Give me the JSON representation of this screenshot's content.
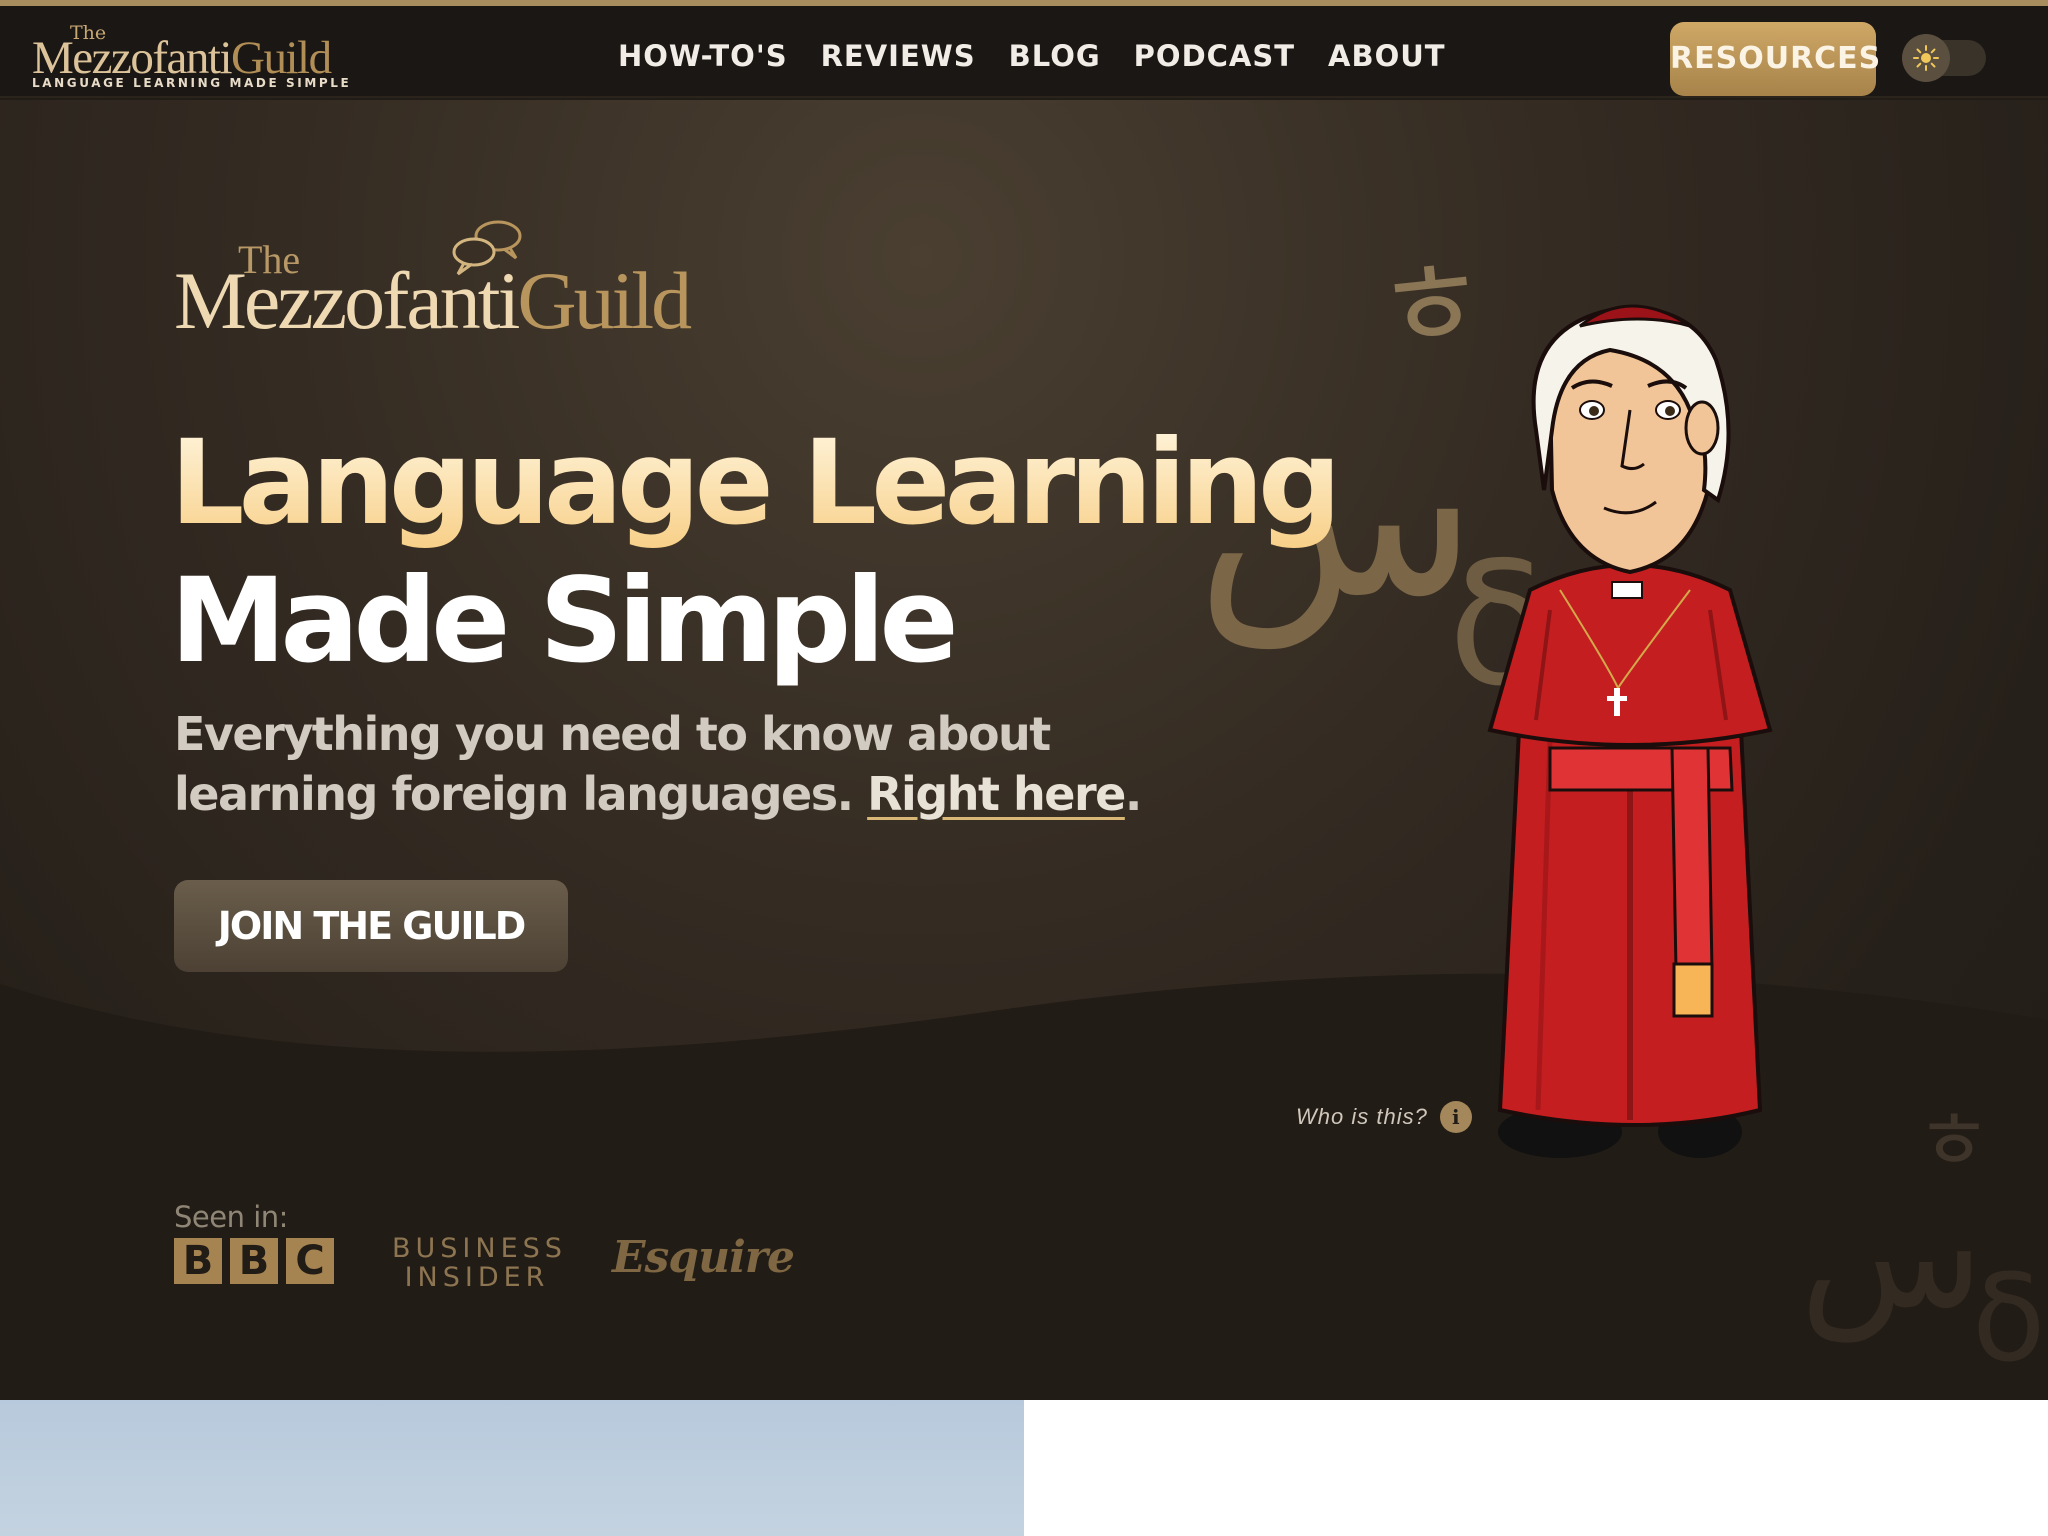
{
  "nav": {
    "logo_the": "The",
    "logo_name_a": "Mezzofanti",
    "logo_name_b": "Guild",
    "logo_tagline": "LANGUAGE LEARNING MADE SIMPLE",
    "menu": [
      {
        "label": "HOW-TO'S"
      },
      {
        "label": "REVIEWS"
      },
      {
        "label": "BLOG"
      },
      {
        "label": "PODCAST"
      },
      {
        "label": "ABOUT"
      }
    ],
    "resources_label": "RESOURCES",
    "theme_toggle_icon": "sun-icon"
  },
  "hero": {
    "logo_the": "The",
    "logo_name_a": "Mezzofanti",
    "logo_name_b": "Guild",
    "headline_line1": "Language Learning",
    "headline_line2": "Made Simple",
    "subtitle_text": "Everything you need to know about learning foreign languages.",
    "subtitle_link": "Right here",
    "subtitle_end": ".",
    "cta_label": "JOIN THE GUILD",
    "who_label": "Who is this?",
    "info_icon": "i",
    "seen_in_label": "Seen in:",
    "press": {
      "bbc_letters": [
        "B",
        "B",
        "C"
      ],
      "business_insider_line1": "BUSINESS",
      "business_insider_line2": "INSIDER",
      "esquire": "Esquire"
    },
    "glyph_korean": "ㅎ",
    "glyph_arabic": "س",
    "glyph_greek": "δ"
  },
  "colors": {
    "nav_bg": "#1b1714",
    "hero_bg": "#221c16",
    "accent_gold": "#c29d5f",
    "cardinal_red": "#c41e20"
  }
}
